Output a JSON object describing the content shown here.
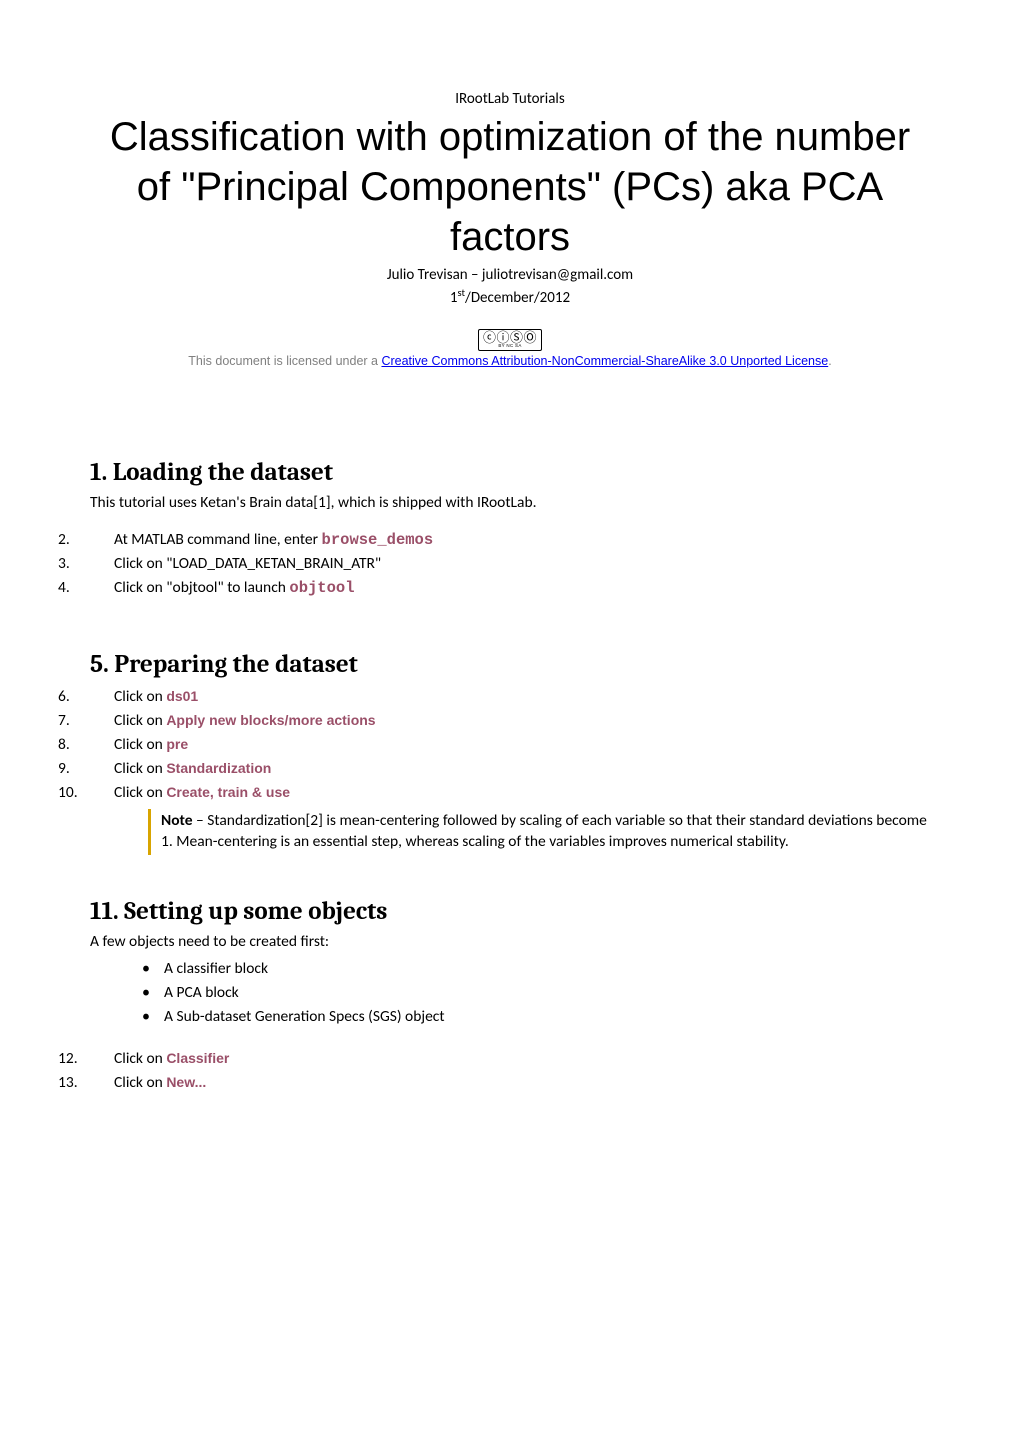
{
  "header_series": "IRootLab Tutorials",
  "title_line1": "Classification with optimization of the number",
  "title_line2": "of \"Principal Components\" (PCs) aka PCA",
  "title_line3": "factors",
  "author": "Julio Trevisan – juliotrevisan@gmail.com",
  "date_pre": "1",
  "date_sup": "st",
  "date_post": "/December/2012",
  "cc_symbols": "ⓒⓘⓈⓄ",
  "cc_tiny": "BY  NC  SA",
  "license_prefix": "This document is licensed under a ",
  "license_link_text": "Creative Commons Attribution-NonCommercial-ShareAlike 3.0 Unported License",
  "license_suffix": ".",
  "s1": {
    "heading": "1. Loading the dataset",
    "intro": "This tutorial uses Ketan's Brain data[1], which is shipped with IRootLab.",
    "step2_pre": "At MATLAB command line, enter ",
    "step2_code": "browse_demos",
    "step3": "Click on \"LOAD_DATA_KETAN_BRAIN_ATR\"",
    "step4_pre": "Click on \"objtool\"  to launch ",
    "step4_code": "objtool"
  },
  "s2": {
    "heading": "5. Preparing the dataset",
    "step6_pre": "Click on ",
    "step6_code": "ds01",
    "step7_pre": "Click on ",
    "step7_code": "Apply new blocks/more actions",
    "step8_pre": "Click on ",
    "step8_code": "pre",
    "step9_pre": "Click on ",
    "step9_code": "Standardization",
    "step10_pre": "Click on ",
    "step10_code": "Create, train & use",
    "note_label": "Note",
    "note_body": " – Standardization[2] is mean-centering followed by scaling of each variable so that their standard deviations become 1. Mean-centering is an essential step, whereas scaling of the variables improves numerical stability."
  },
  "s3": {
    "heading": "11.    Setting up some objects",
    "intro": "A few objects need to be created first:",
    "bullets": {
      "b1": "A classifier block",
      "b2": "A PCA block",
      "b3": "A Sub-dataset Generation Specs (SGS) object"
    },
    "step12_pre": "Click on ",
    "step12_code": "Classifier",
    "step13_pre": "Click on ",
    "step13_code": "New..."
  }
}
